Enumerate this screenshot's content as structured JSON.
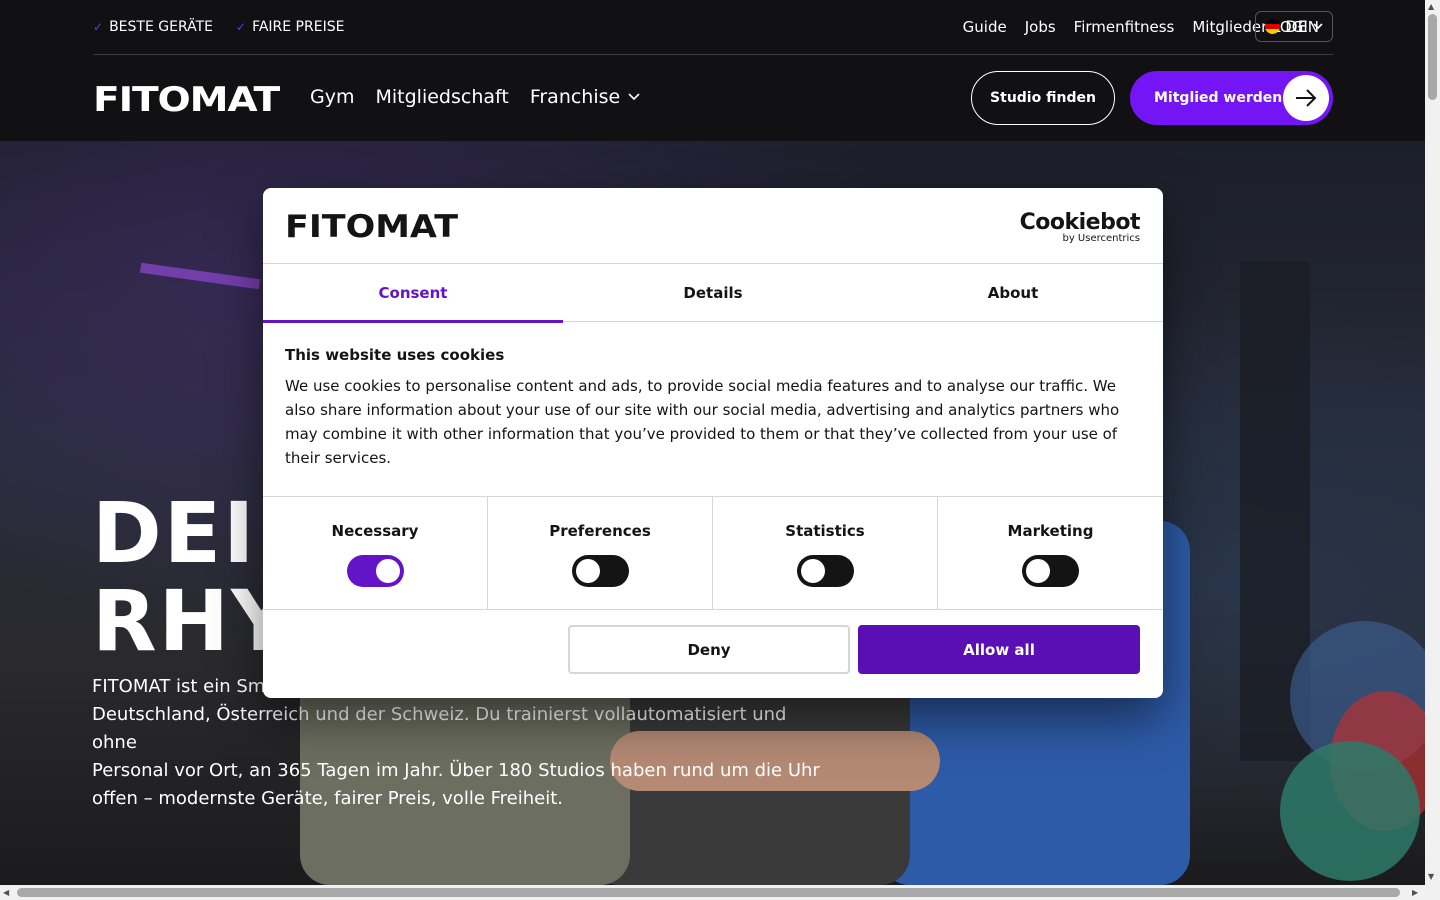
{
  "topbar": {
    "usp": [
      "BESTE GERÄTE",
      "FAIRE PREISE"
    ],
    "links": [
      "Guide",
      "Jobs",
      "Firmenfitness",
      "Mitglieder LOGIN"
    ],
    "language": "DE"
  },
  "brand": {
    "logo_text": "FITOMAT"
  },
  "nav": {
    "items": [
      "Gym",
      "Mitgliedschaft",
      "Franchise"
    ]
  },
  "buttons": {
    "studio": "Studio finden",
    "member": "Mitglied werden"
  },
  "hero": {
    "title_line1": "DEIN",
    "title_line2": "RHY",
    "text": "FITOMAT ist ein Sma Deutschland, Österreich und der Schweiz. Du trainierst vollautomatisiert und ohne Personal vor Ort, an 365 Tagen im Jahr. Über 180 Studios haben rund um die Uhr offen – modernste Geräte, fairer Preis, volle Freiheit.",
    "text_line1": "FITOMAT ist ein Sma",
    "text_line2": "Deutschland, Österreich und der Schweiz. Du trainierst vollautomatisiert und ohne",
    "text_line3": "Personal vor Ort, an 365 Tagen im Jahr. Über 180 Studios haben rund um die Uhr",
    "text_line4": "offen – modernste Geräte, fairer Preis, volle Freiheit."
  },
  "cookie_dialog": {
    "logo_text": "FITOMAT",
    "provider": "Cookiebot",
    "provider_sub": "by Usercentrics",
    "tabs": [
      {
        "label": "Consent",
        "active": true
      },
      {
        "label": "Details",
        "active": false
      },
      {
        "label": "About",
        "active": false
      }
    ],
    "heading": "This website uses cookies",
    "body": "We use cookies to personalise content and ads, to provide social media features and to analyse our traffic. We also share information about your use of our site with our social media, advertising and analytics partners who may combine it with other information that you’ve provided to them or that they’ve collected from your use of their services.",
    "toggles": [
      {
        "label": "Necessary",
        "on": true
      },
      {
        "label": "Preferences",
        "on": false
      },
      {
        "label": "Statistics",
        "on": false
      },
      {
        "label": "Marketing",
        "on": false
      }
    ],
    "deny_label": "Deny",
    "allow_label": "Allow all"
  },
  "colors": {
    "accent": "#7415f5",
    "dialog_accent": "#6414c8",
    "allow_button": "#5a0fb4"
  },
  "icons": [
    "check-icon",
    "germany-flag-icon",
    "chevron-down-icon",
    "arrow-right-icon"
  ]
}
